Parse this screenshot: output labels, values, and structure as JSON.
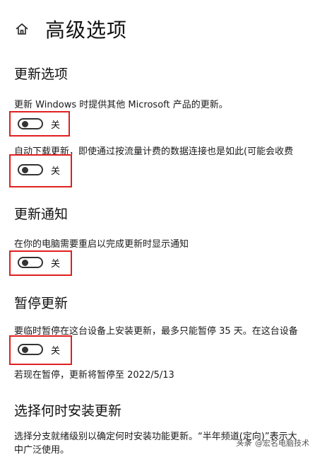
{
  "header": {
    "title": "高级选项",
    "home_icon": "home-icon"
  },
  "sections": {
    "update_options": {
      "heading": "更新选项",
      "option1_desc": "更新 Windows 时提供其他 Microsoft 产品的更新。",
      "option1_state": "关",
      "option2_desc": "自动下载更新，即使通过按流量计费的数据连接也是如此(可能会收费",
      "option2_state": "关"
    },
    "update_notify": {
      "heading": "更新通知",
      "option_desc": "在你的电脑需要重启以完成更新时显示通知",
      "option_state": "关"
    },
    "pause": {
      "heading": "暂停更新",
      "option_desc": "要临时暂停在这台设备上安装更新，最多只能暂停 35 天。在这台设备",
      "option_state": "关",
      "note": "若现在暂停，更新将暂停至 2022/5/13"
    },
    "when_install": {
      "heading": "选择何时安装更新",
      "desc_line1": "选择分支就绪级别以确定何时安装功能更新。“半年频道(定向)”表示大",
      "desc_line2": "中广泛使用。"
    }
  },
  "watermark": {
    "logo": "头条",
    "text": "@宏名电脑技术"
  },
  "colors": {
    "highlight": "#e02020",
    "toggle": "#333333",
    "text": "#111111"
  }
}
